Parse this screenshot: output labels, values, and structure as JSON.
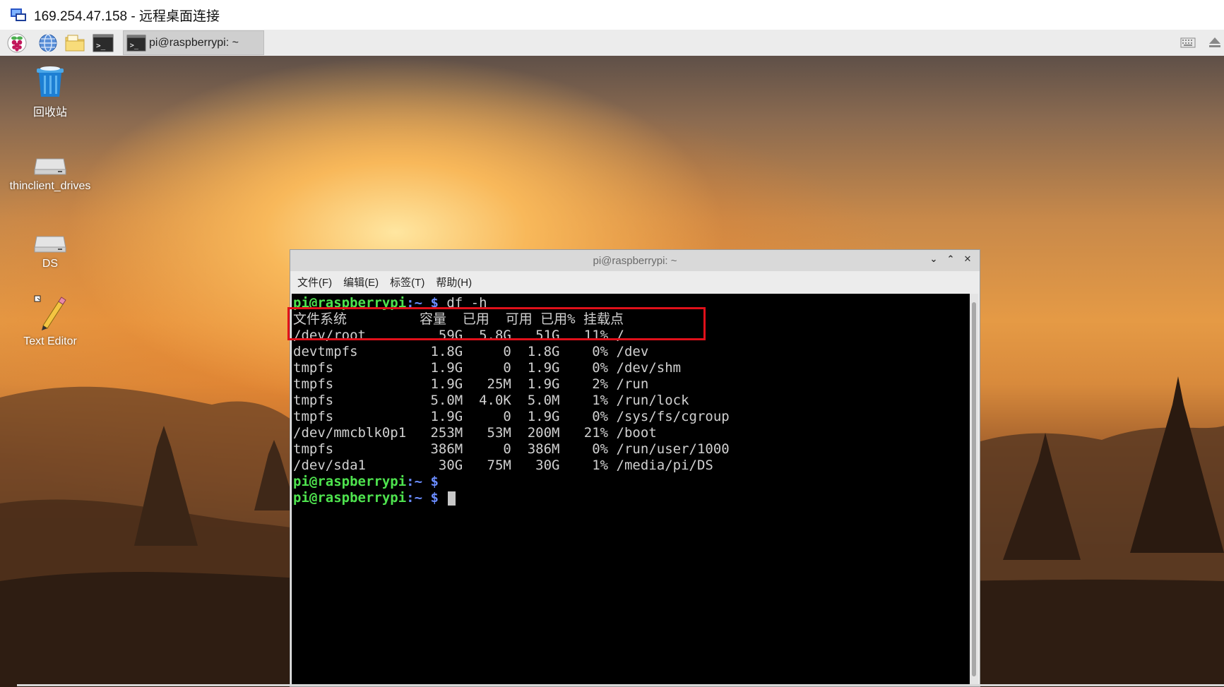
{
  "rdp": {
    "title": "169.254.47.158 - 远程桌面连接"
  },
  "taskbar": {
    "task_label": "pi@raspberrypi: ~",
    "icons": [
      "raspberry-menu-icon",
      "web-browser-icon",
      "file-manager-icon",
      "terminal-icon"
    ]
  },
  "desktop": {
    "icons": [
      {
        "label": "回收站",
        "icon": "trash-icon"
      },
      {
        "label": "thinclient_drives",
        "icon": "drive-icon"
      },
      {
        "label": "DS",
        "icon": "drive-icon"
      },
      {
        "label": "Text Editor",
        "icon": "text-editor-icon"
      }
    ]
  },
  "terminal": {
    "title": "pi@raspberrypi: ~",
    "menu": [
      "文件(F)",
      "编辑(E)",
      "标签(T)",
      "帮助(H)"
    ],
    "prompt_user": "pi@raspberrypi",
    "prompt_sym": ":~ $",
    "command": " df -h",
    "header": "文件系统         容量  已用  可用 已用% 挂载点",
    "rows": [
      "/dev/root         59G  5.8G   51G   11% /",
      "devtmpfs         1.8G     0  1.8G    0% /dev",
      "tmpfs            1.9G     0  1.9G    0% /dev/shm",
      "tmpfs            1.9G   25M  1.9G    2% /run",
      "tmpfs            5.0M  4.0K  5.0M    1% /run/lock",
      "tmpfs            1.9G     0  1.9G    0% /sys/fs/cgroup",
      "/dev/mmcblk0p1   253M   53M  200M   21% /boot",
      "tmpfs            386M     0  386M    0% /run/user/1000",
      "/dev/sda1         30G   75M   30G    1% /media/pi/DS"
    ]
  },
  "colors": {
    "prompt_green": "#4ee34e",
    "prompt_blue": "#6a8cff",
    "highlight_red": "#e0101a"
  }
}
